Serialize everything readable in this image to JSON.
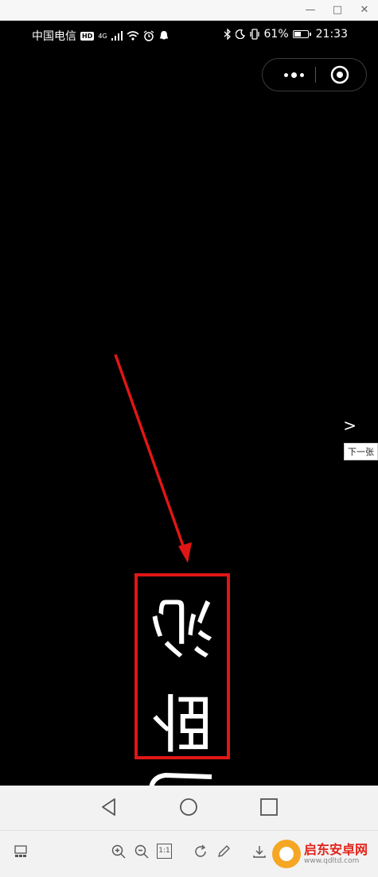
{
  "window": {
    "minimize": "—",
    "maximize": "□",
    "close": "✕"
  },
  "status_bar": {
    "carrier": "中国电信",
    "hd_badge": "HD",
    "network_type": "4G",
    "battery_percent": "61%",
    "battery_level": 0.61,
    "time": "21:33"
  },
  "viewer": {
    "next_label": "下一张",
    "image_glyphs": [
      "沁",
      "卧"
    ]
  },
  "toolbar": {
    "actual_size": "1:1"
  },
  "watermark": {
    "brand": "启东安卓网",
    "url": "www.qdltd.com"
  },
  "colors": {
    "highlight": "#e01616",
    "arrow": "#e01616",
    "viewer_bg": "#000000",
    "toolbar_bg": "#f2f2f2"
  }
}
